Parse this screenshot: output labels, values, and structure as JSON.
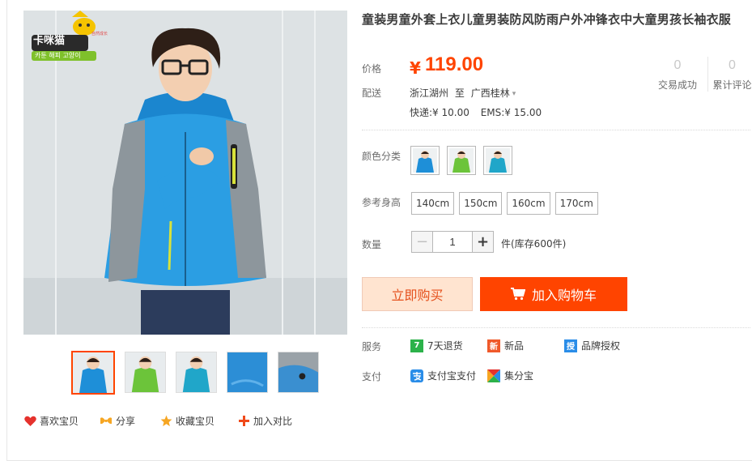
{
  "product": {
    "title": "童装男童外套上衣儿童男装防风防雨户外冲锋衣中大童男孩长袖衣服",
    "brand_logo_text": "卡咪猫",
    "brand_logo_sub": "카툰 해피 고양이",
    "brand_logo_corner": "自然成长"
  },
  "price": {
    "label": "价格",
    "symbol": "¥",
    "value": "119.00",
    "color": "#ff4400"
  },
  "stats": [
    {
      "num": "0",
      "label": "交易成功"
    },
    {
      "num": "0",
      "label": "累计评论"
    }
  ],
  "shipping": {
    "label": "配送",
    "from": "浙江湖州",
    "to_word": "至",
    "to": "广西桂林",
    "express": "快递:¥ 10.00",
    "ems": "EMS:¥ 15.00"
  },
  "color": {
    "label": "颜色分类",
    "swatches": [
      {
        "name": "blue",
        "jacket": "#1e8fd8"
      },
      {
        "name": "green",
        "jacket": "#6cc43a"
      },
      {
        "name": "cyan",
        "jacket": "#20a6c9"
      }
    ]
  },
  "size": {
    "label": "参考身高",
    "options": [
      "140cm",
      "150cm",
      "160cm",
      "170cm"
    ]
  },
  "quantity": {
    "label": "数量",
    "minus": "−",
    "plus": "+",
    "value": "1",
    "stock": "件(库存600件)"
  },
  "buttons": {
    "buy_now": "立即购买",
    "add_to_cart": "加入购物车"
  },
  "services": {
    "label": "服务",
    "items": [
      {
        "icon": "seven-day-return-icon",
        "badge": "7",
        "color": "#2cb24a",
        "text": "7天退货"
      },
      {
        "icon": "new-product-icon",
        "badge": "新",
        "color": "#f0592a",
        "text": "新品"
      },
      {
        "icon": "brand-authorized-icon",
        "badge": "授",
        "color": "#2a8de8",
        "text": "品牌授权"
      }
    ]
  },
  "payment": {
    "label": "支付",
    "items": [
      {
        "icon": "alipay-icon",
        "text": "支付宝支付"
      },
      {
        "icon": "jifenbao-icon",
        "text": "集分宝"
      }
    ]
  },
  "social": {
    "like": "喜欢宝贝",
    "share": "分享",
    "favorite": "收藏宝贝",
    "compare": "加入对比"
  },
  "thumbnails": [
    {
      "name": "blue-jacket",
      "jacket": "#1e8fd8"
    },
    {
      "name": "green-jacket",
      "jacket": "#6cc43a"
    },
    {
      "name": "cyan-jacket",
      "jacket": "#20a6c9"
    },
    {
      "name": "fabric-closeup",
      "jacket": "#2c8ed6"
    },
    {
      "name": "hood-detail",
      "jacket": "#3a8fd0"
    }
  ]
}
